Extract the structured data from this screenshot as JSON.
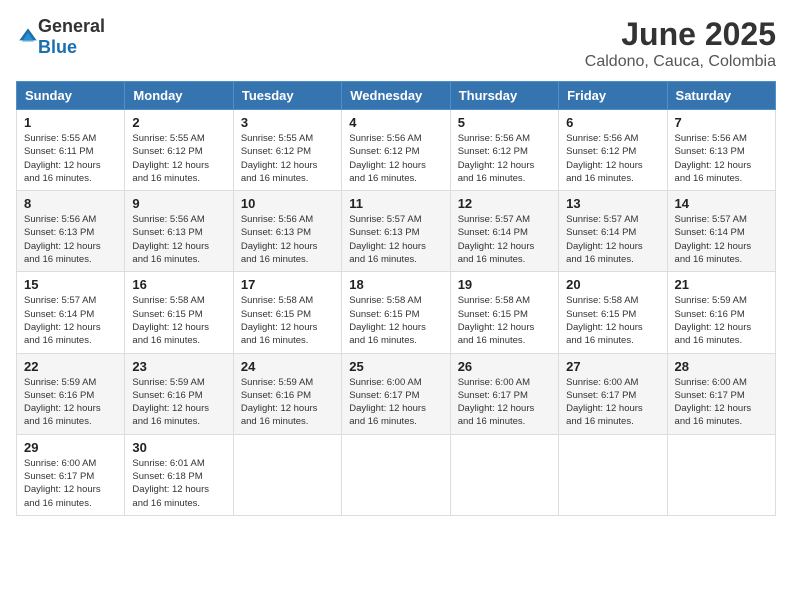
{
  "logo": {
    "general": "General",
    "blue": "Blue"
  },
  "title": "June 2025",
  "subtitle": "Caldono, Cauca, Colombia",
  "headers": [
    "Sunday",
    "Monday",
    "Tuesday",
    "Wednesday",
    "Thursday",
    "Friday",
    "Saturday"
  ],
  "weeks": [
    [
      {
        "day": "1",
        "sunrise": "5:55 AM",
        "sunset": "6:11 PM",
        "daylight": "12 hours and 16 minutes."
      },
      {
        "day": "2",
        "sunrise": "5:55 AM",
        "sunset": "6:12 PM",
        "daylight": "12 hours and 16 minutes."
      },
      {
        "day": "3",
        "sunrise": "5:55 AM",
        "sunset": "6:12 PM",
        "daylight": "12 hours and 16 minutes."
      },
      {
        "day": "4",
        "sunrise": "5:56 AM",
        "sunset": "6:12 PM",
        "daylight": "12 hours and 16 minutes."
      },
      {
        "day": "5",
        "sunrise": "5:56 AM",
        "sunset": "6:12 PM",
        "daylight": "12 hours and 16 minutes."
      },
      {
        "day": "6",
        "sunrise": "5:56 AM",
        "sunset": "6:12 PM",
        "daylight": "12 hours and 16 minutes."
      },
      {
        "day": "7",
        "sunrise": "5:56 AM",
        "sunset": "6:13 PM",
        "daylight": "12 hours and 16 minutes."
      }
    ],
    [
      {
        "day": "8",
        "sunrise": "5:56 AM",
        "sunset": "6:13 PM",
        "daylight": "12 hours and 16 minutes."
      },
      {
        "day": "9",
        "sunrise": "5:56 AM",
        "sunset": "6:13 PM",
        "daylight": "12 hours and 16 minutes."
      },
      {
        "day": "10",
        "sunrise": "5:56 AM",
        "sunset": "6:13 PM",
        "daylight": "12 hours and 16 minutes."
      },
      {
        "day": "11",
        "sunrise": "5:57 AM",
        "sunset": "6:13 PM",
        "daylight": "12 hours and 16 minutes."
      },
      {
        "day": "12",
        "sunrise": "5:57 AM",
        "sunset": "6:14 PM",
        "daylight": "12 hours and 16 minutes."
      },
      {
        "day": "13",
        "sunrise": "5:57 AM",
        "sunset": "6:14 PM",
        "daylight": "12 hours and 16 minutes."
      },
      {
        "day": "14",
        "sunrise": "5:57 AM",
        "sunset": "6:14 PM",
        "daylight": "12 hours and 16 minutes."
      }
    ],
    [
      {
        "day": "15",
        "sunrise": "5:57 AM",
        "sunset": "6:14 PM",
        "daylight": "12 hours and 16 minutes."
      },
      {
        "day": "16",
        "sunrise": "5:58 AM",
        "sunset": "6:15 PM",
        "daylight": "12 hours and 16 minutes."
      },
      {
        "day": "17",
        "sunrise": "5:58 AM",
        "sunset": "6:15 PM",
        "daylight": "12 hours and 16 minutes."
      },
      {
        "day": "18",
        "sunrise": "5:58 AM",
        "sunset": "6:15 PM",
        "daylight": "12 hours and 16 minutes."
      },
      {
        "day": "19",
        "sunrise": "5:58 AM",
        "sunset": "6:15 PM",
        "daylight": "12 hours and 16 minutes."
      },
      {
        "day": "20",
        "sunrise": "5:58 AM",
        "sunset": "6:15 PM",
        "daylight": "12 hours and 16 minutes."
      },
      {
        "day": "21",
        "sunrise": "5:59 AM",
        "sunset": "6:16 PM",
        "daylight": "12 hours and 16 minutes."
      }
    ],
    [
      {
        "day": "22",
        "sunrise": "5:59 AM",
        "sunset": "6:16 PM",
        "daylight": "12 hours and 16 minutes."
      },
      {
        "day": "23",
        "sunrise": "5:59 AM",
        "sunset": "6:16 PM",
        "daylight": "12 hours and 16 minutes."
      },
      {
        "day": "24",
        "sunrise": "5:59 AM",
        "sunset": "6:16 PM",
        "daylight": "12 hours and 16 minutes."
      },
      {
        "day": "25",
        "sunrise": "6:00 AM",
        "sunset": "6:17 PM",
        "daylight": "12 hours and 16 minutes."
      },
      {
        "day": "26",
        "sunrise": "6:00 AM",
        "sunset": "6:17 PM",
        "daylight": "12 hours and 16 minutes."
      },
      {
        "day": "27",
        "sunrise": "6:00 AM",
        "sunset": "6:17 PM",
        "daylight": "12 hours and 16 minutes."
      },
      {
        "day": "28",
        "sunrise": "6:00 AM",
        "sunset": "6:17 PM",
        "daylight": "12 hours and 16 minutes."
      }
    ],
    [
      {
        "day": "29",
        "sunrise": "6:00 AM",
        "sunset": "6:17 PM",
        "daylight": "12 hours and 16 minutes."
      },
      {
        "day": "30",
        "sunrise": "6:01 AM",
        "sunset": "6:18 PM",
        "daylight": "12 hours and 16 minutes."
      },
      null,
      null,
      null,
      null,
      null
    ]
  ],
  "labels": {
    "sunrise": "Sunrise:",
    "sunset": "Sunset:",
    "daylight": "Daylight:"
  }
}
